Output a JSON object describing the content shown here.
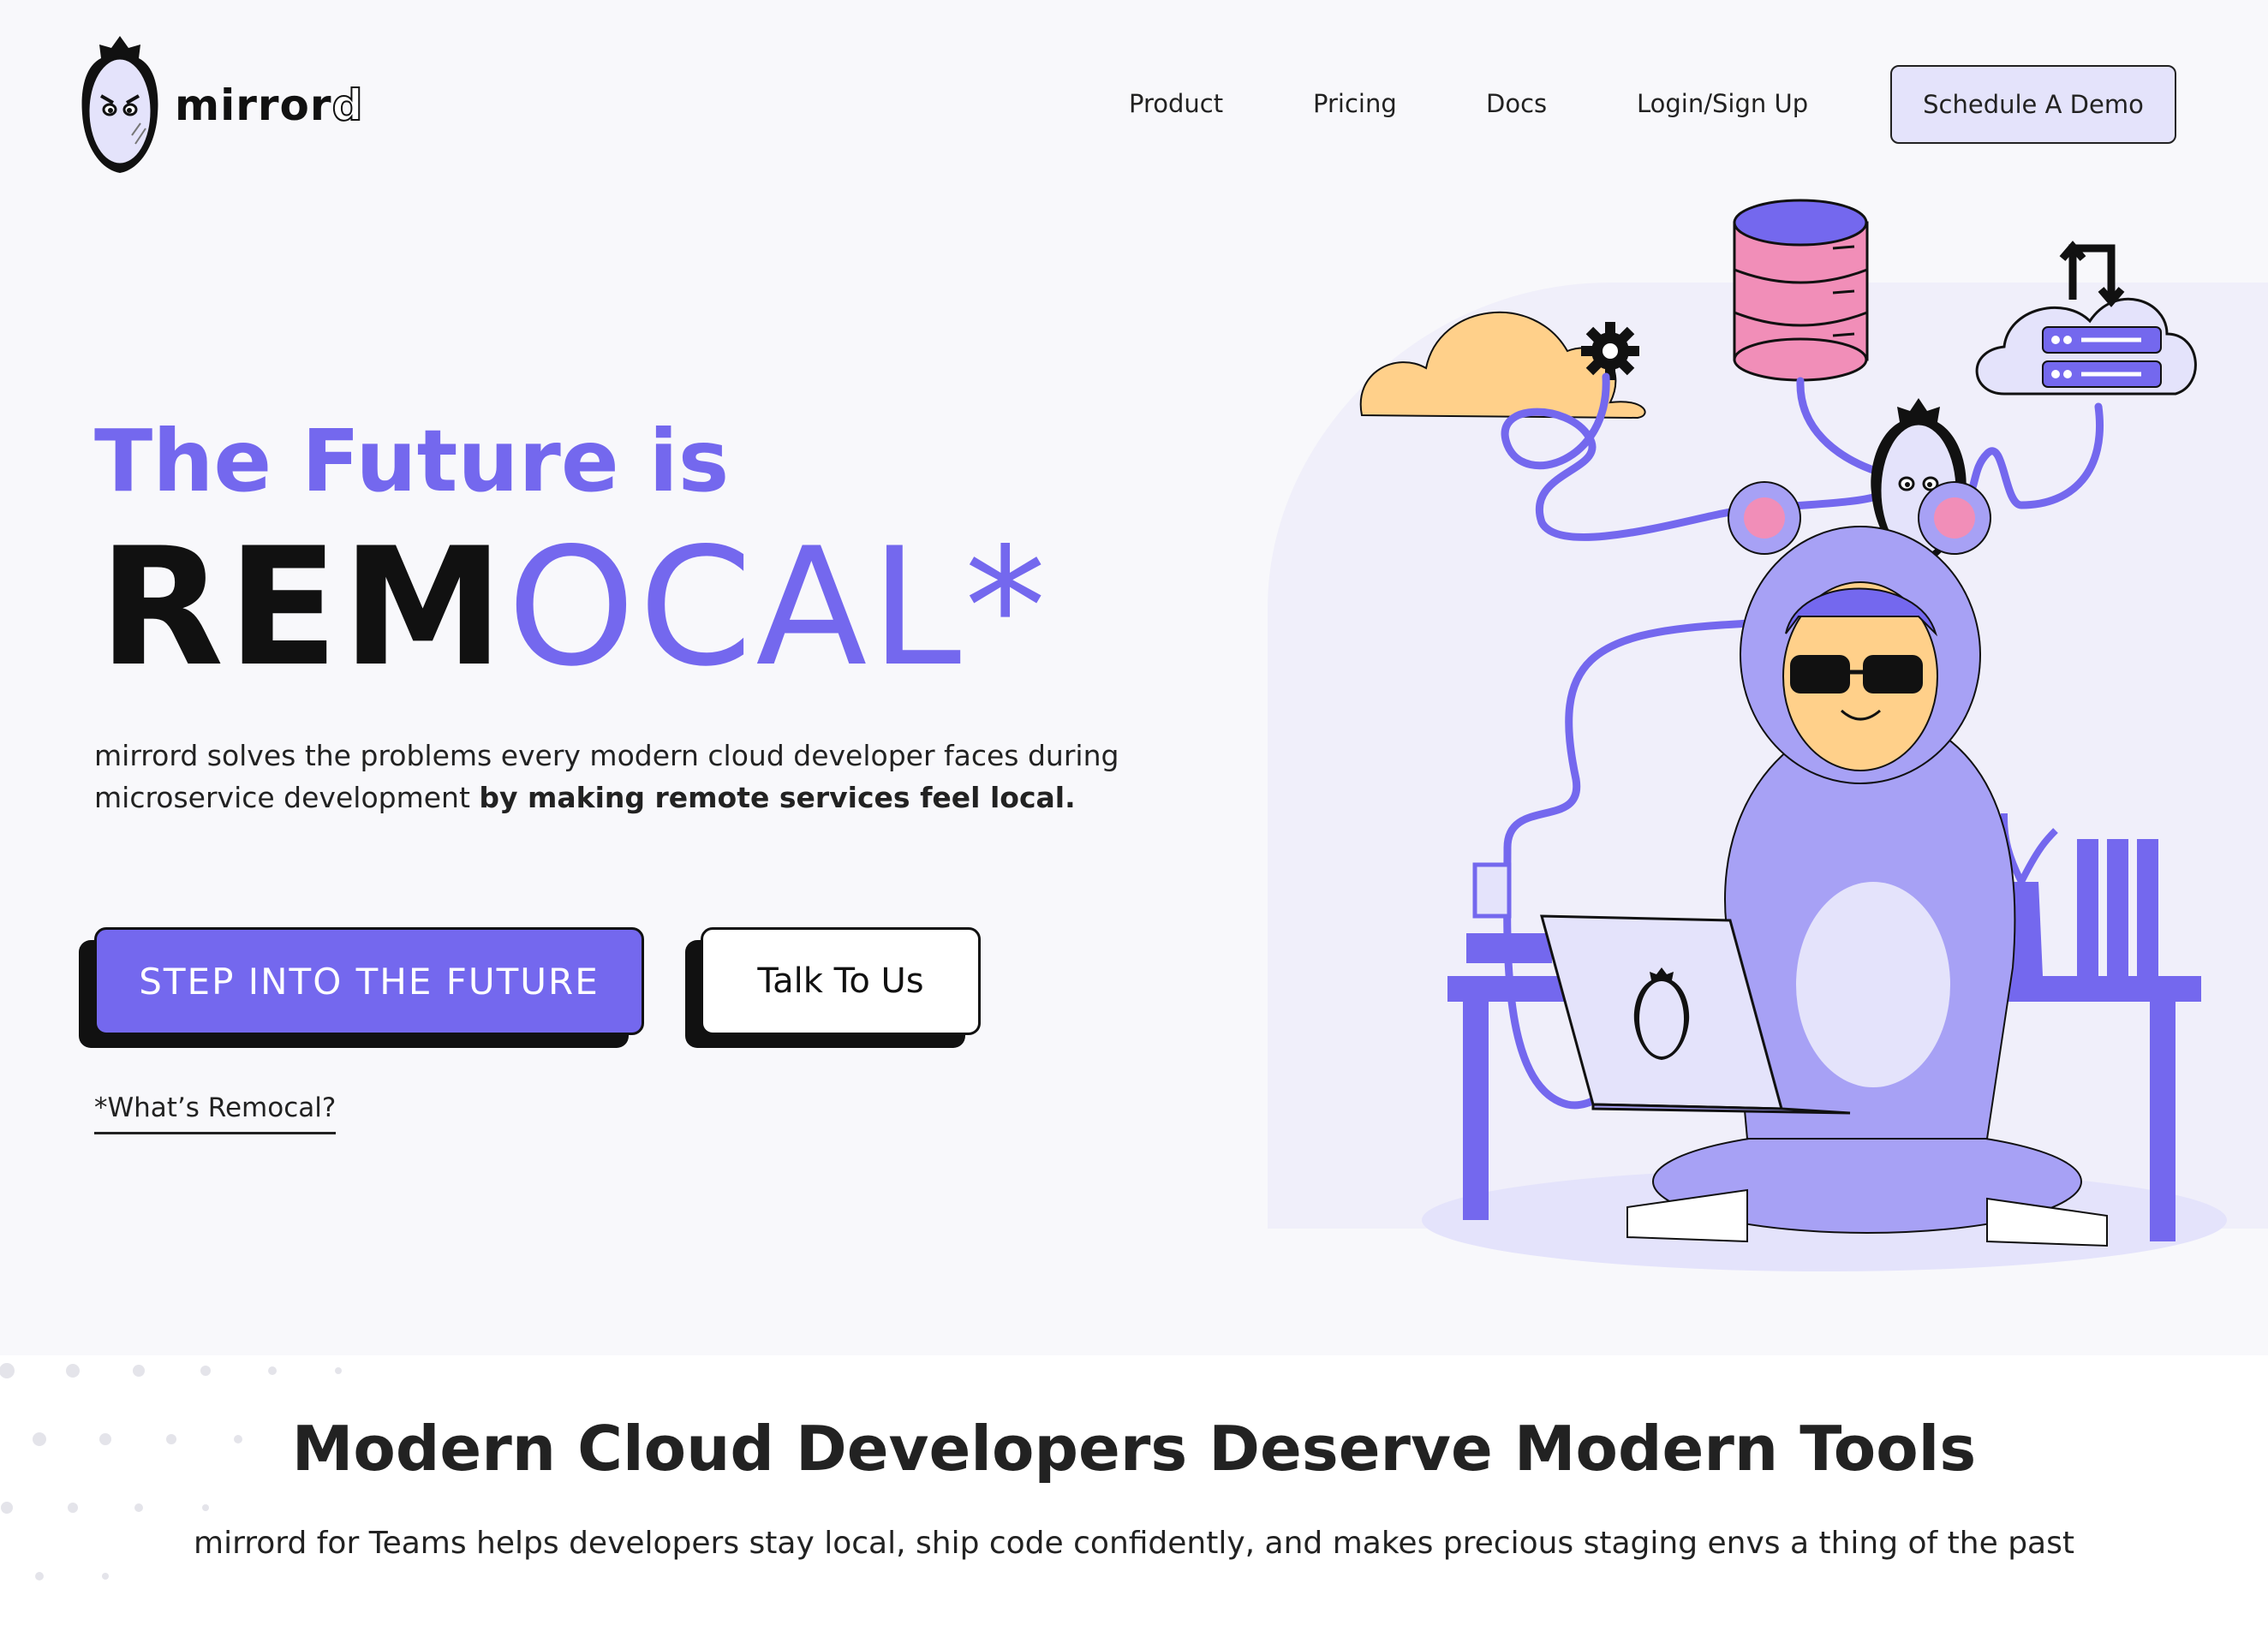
{
  "header": {
    "logo_text_main": "mirror",
    "logo_text_end": "d",
    "nav": [
      {
        "label": "Product"
      },
      {
        "label": "Pricing"
      },
      {
        "label": "Docs"
      },
      {
        "label": "Login/Sign Up"
      }
    ],
    "demo_button": "Schedule A Demo"
  },
  "hero": {
    "pre_title": "The Future is",
    "big_black": "REM",
    "big_purple": "OCAL*",
    "description": "mirrord solves the problems every modern cloud developer faces during microservice development ",
    "description_bold": "by making remote services feel local.",
    "primary_cta": "STEP INTO THE FUTURE",
    "secondary_cta": "Talk To Us",
    "remocal_link": "*What’s Remocal?"
  },
  "section2": {
    "title": "Modern Cloud Developers Deserve Modern Tools",
    "subtitle": "mirrord for Teams helps developers stay local, ship code confidently, and makes precious staging envs a thing of the past"
  },
  "colors": {
    "accent": "#7468ee",
    "background": "#f8f8fb",
    "lavender": "#e4e3fb",
    "cloud_orange": "#ffd08a",
    "pink": "#f18eb8"
  }
}
